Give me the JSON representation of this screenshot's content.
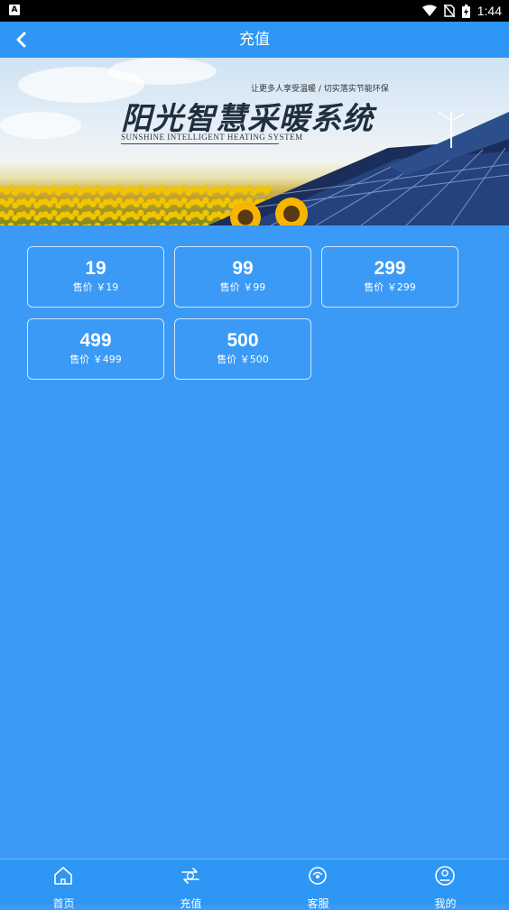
{
  "status_bar": {
    "time": "1:44",
    "app_indicator": "A"
  },
  "header": {
    "title": "充值",
    "back_icon": "chevron-left-icon"
  },
  "banner": {
    "slogan": "让更多人享受温暖 / 切实落实节能环保",
    "title": "阳光智慧采暖系统",
    "subtitle": "SUNSHINE INTELLIGENT HEATING SYSTEM"
  },
  "recharge_options": [
    {
      "amount": "19",
      "price": "售价 ￥19"
    },
    {
      "amount": "99",
      "price": "售价 ￥99"
    },
    {
      "amount": "299",
      "price": "售价 ￥299"
    },
    {
      "amount": "499",
      "price": "售价 ￥499"
    },
    {
      "amount": "500",
      "price": "售价 ￥500"
    }
  ],
  "bottom_nav": [
    {
      "icon": "home-icon",
      "label": "首页"
    },
    {
      "icon": "exchange-icon",
      "label": "充值"
    },
    {
      "icon": "service-icon",
      "label": "客服"
    },
    {
      "icon": "profile-icon",
      "label": "我的"
    }
  ],
  "colors": {
    "background": "#3a9af6",
    "header": "#2e96f5",
    "status_bar": "#000000"
  }
}
